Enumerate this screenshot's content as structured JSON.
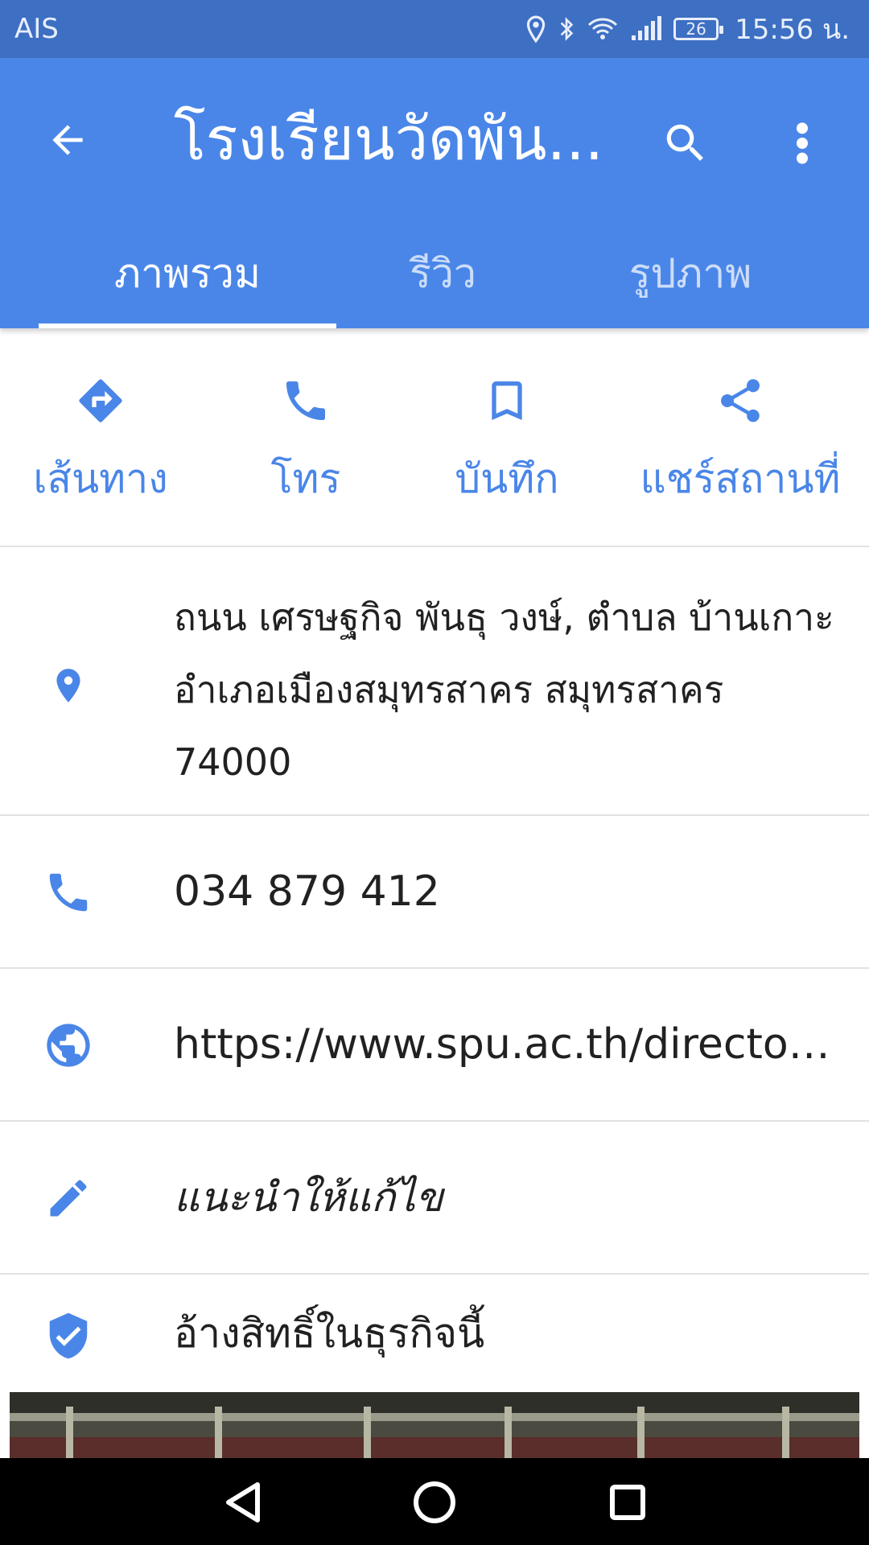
{
  "status_bar": {
    "carrier": "AIS",
    "battery": "26",
    "time": "15:56 น."
  },
  "header": {
    "title": "โรงเรียนวัดพัน...",
    "tabs": [
      {
        "label": "ภาพรวม",
        "active": true
      },
      {
        "label": "รีวิว",
        "active": false
      },
      {
        "label": "รูปภาพ",
        "active": false
      }
    ]
  },
  "actions": [
    {
      "label": "เส้นทาง",
      "icon": "directions-icon"
    },
    {
      "label": "โทร",
      "icon": "phone-icon"
    },
    {
      "label": "บันทึก",
      "icon": "bookmark-icon"
    },
    {
      "label": "แชร์สถานที่",
      "icon": "share-icon"
    }
  ],
  "details": {
    "address": "ถนน เศรษฐกิจ พันธุ วงษ์, ตำบล บ้านเกาะ อำเภอเมืองสมุทรสาคร สมุทรสาคร 74000",
    "phone": "034 879 412",
    "website": "https://www.spu.ac.th/directory…",
    "suggest_edit": "แนะนำให้แก้ไข",
    "claim": "อ้างสิทธิ์ในธุรกิจนี้"
  },
  "colors": {
    "status_bar": "#3d6fc3",
    "app_bar": "#4a86e8",
    "accent": "#4a86e8",
    "text_primary": "#212121",
    "divider": "#e2e2e2",
    "nav_bar": "#000000"
  }
}
